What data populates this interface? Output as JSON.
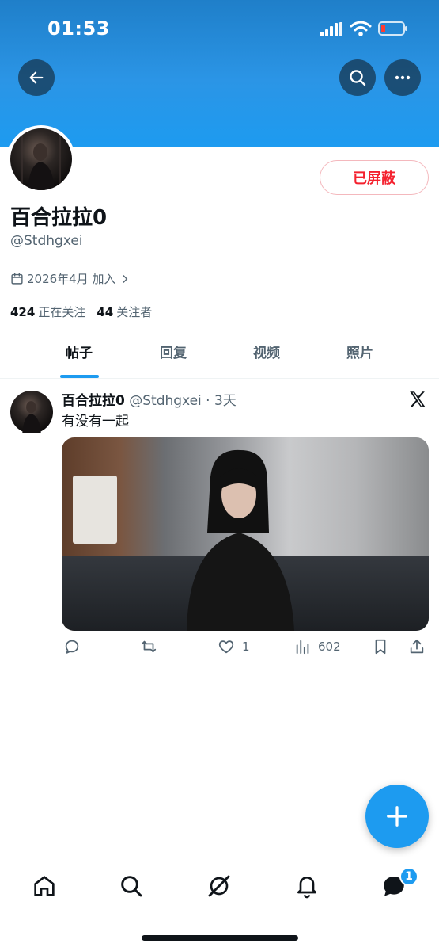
{
  "status_bar": {
    "time": "01:53"
  },
  "header": {
    "back_icon": "arrow-left-icon",
    "search_icon": "search-icon",
    "more_icon": "more-horizontal-icon"
  },
  "profile": {
    "display_name": "百合拉拉0",
    "handle": "@Stdhgxei",
    "blocked_label": "已屏蔽",
    "joined": "2026年4月 加入",
    "following_count": "424",
    "following_label": "正在关注",
    "followers_count": "44",
    "followers_label": "关注者"
  },
  "tabs": [
    {
      "label": "帖子",
      "active": true
    },
    {
      "label": "回复",
      "active": false
    },
    {
      "label": "视频",
      "active": false
    },
    {
      "label": "照片",
      "active": false
    }
  ],
  "tweet": {
    "name": "百合拉拉0",
    "meta": "@Stdhgxei · 3天",
    "text": "有没有一起",
    "likes": "1",
    "views": "602"
  },
  "bottom_nav": {
    "notification_badge": "1"
  },
  "colors": {
    "accent": "#1d9bf0",
    "blocked": "#f4212e",
    "text": "#0f1419",
    "muted": "#536471"
  }
}
